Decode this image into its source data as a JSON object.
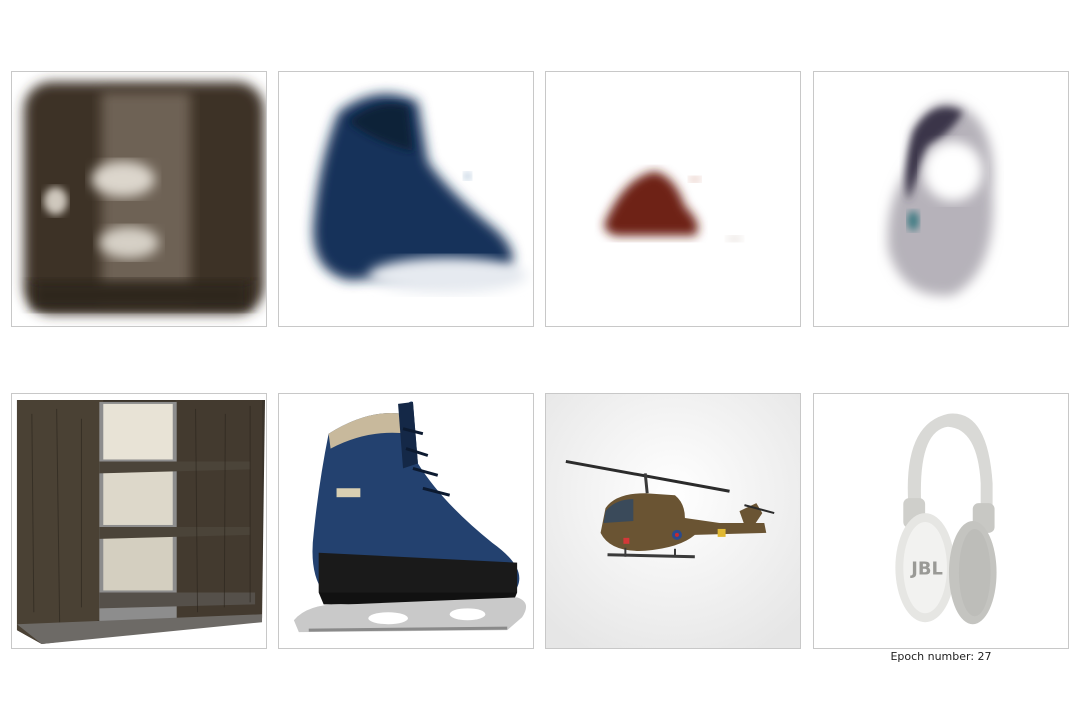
{
  "figure": {
    "epoch_label": "Epoch number: 27"
  },
  "reconstructions": [
    {
      "subject": "shelf-blur"
    },
    {
      "subject": "skate-blur"
    },
    {
      "subject": "helicopter-blur"
    },
    {
      "subject": "headphones-blur"
    }
  ],
  "originals": [
    {
      "subject": "bookshelf"
    },
    {
      "subject": "ice-skate"
    },
    {
      "subject": "toy-helicopter"
    },
    {
      "subject": "headphones"
    }
  ]
}
